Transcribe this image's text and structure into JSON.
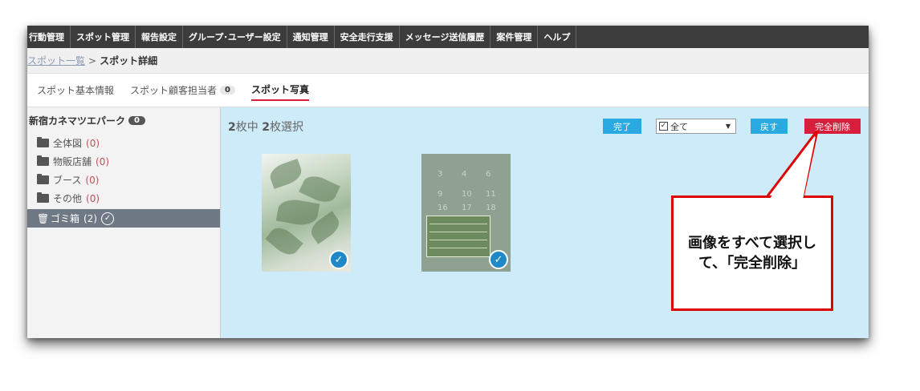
{
  "nav": {
    "items": [
      "行動管理",
      "スポット管理",
      "報告設定",
      "グループ･ユーザー設定",
      "通知管理",
      "安全走行支援",
      "メッセージ送信履歴",
      "案件管理",
      "ヘルプ"
    ]
  },
  "breadcrumb": {
    "link": "スポット一覧",
    "separator": ">",
    "current": "スポット詳細"
  },
  "tabs": [
    {
      "label": "スポット基本情報",
      "count": ""
    },
    {
      "label": "スポット顧客担当者",
      "count": "0"
    },
    {
      "label": "スポット写真",
      "count": ""
    }
  ],
  "sidebar": {
    "title": "新宿カネマツエパーク",
    "title_count": "0",
    "folders": [
      {
        "label": "全体図",
        "count": "(0)"
      },
      {
        "label": "物販店舗",
        "count": "(0)"
      },
      {
        "label": "ブース",
        "count": "(0)"
      },
      {
        "label": "その他",
        "count": "(0)"
      }
    ],
    "trash": {
      "label": "ゴミ箱",
      "count": "(2)"
    }
  },
  "main": {
    "status_total": "2",
    "status_mid": "枚中 ",
    "status_selected": "2",
    "status_suffix": "枚選択",
    "done_button": "完了",
    "select_value": "全て",
    "back_button": "戻す",
    "delete_button": "完全削除",
    "photo2_numbers": [
      "3",
      "4",
      "6",
      "9",
      "10",
      "11",
      "16",
      "17",
      "18"
    ]
  },
  "callout": {
    "text": "画像をすべて選択して、「完全削除」"
  },
  "colors": {
    "accent_blue": "#29abe2",
    "delete_red": "#d81e3c",
    "callout_red": "#e00000",
    "main_bg": "#cdebf8"
  }
}
